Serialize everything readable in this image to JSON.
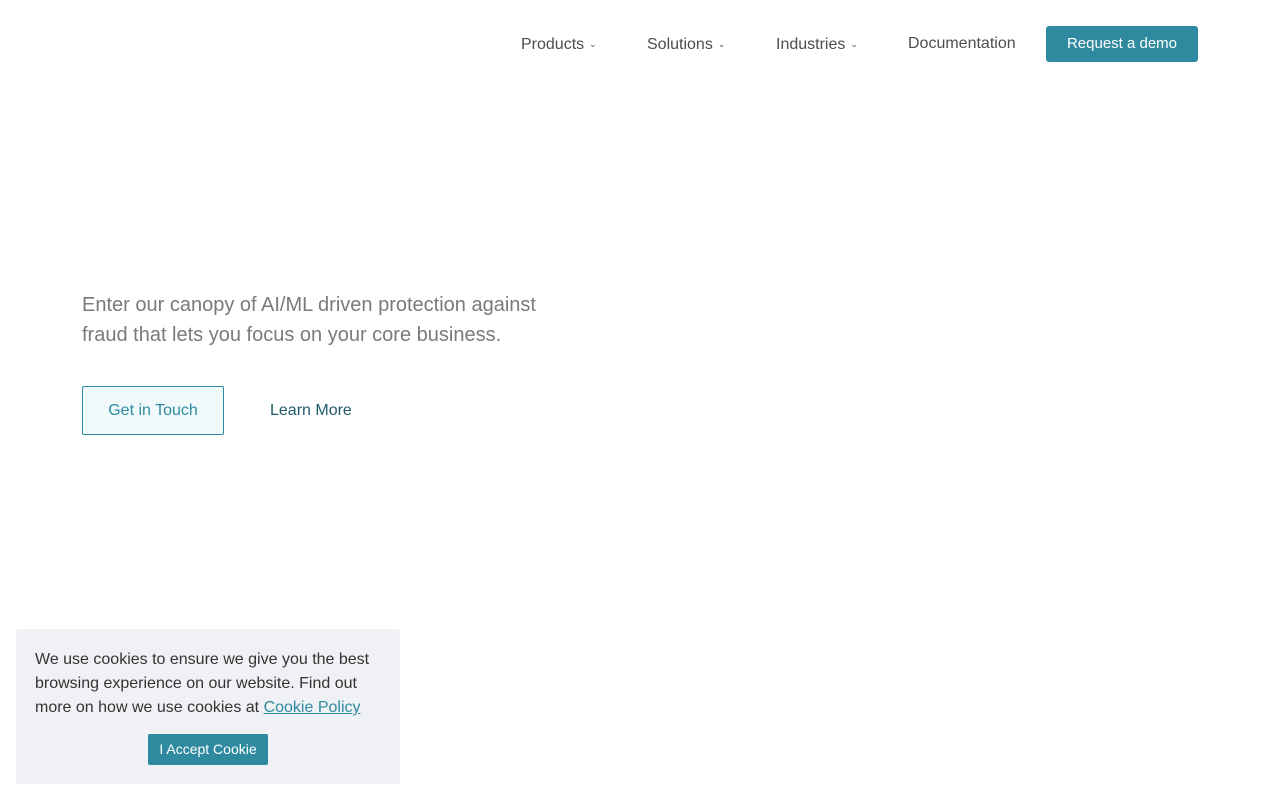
{
  "nav": {
    "items": [
      {
        "label": "Products",
        "has_dropdown": true
      },
      {
        "label": "Solutions",
        "has_dropdown": true
      },
      {
        "label": "Industries",
        "has_dropdown": true
      },
      {
        "label": "Documentation",
        "has_dropdown": false
      }
    ],
    "cta_label": "Request a demo",
    "chevron_glyph": "⌄"
  },
  "hero": {
    "tagline": "Enter our canopy of AI/ML driven protection against fraud that lets you focus on your core business.",
    "primary_button": "Get in Touch",
    "secondary_button": "Learn More"
  },
  "cookie_banner": {
    "message": "We use cookies to ensure we give you the best browsing experience on our website. Find out more on how we use cookies at ",
    "link_label": "Cookie Policy",
    "accept_label": "I Accept Cookie"
  },
  "colors": {
    "accent": "#2f8aa0",
    "nav_text": "#4d4d4d",
    "hero_text": "#7a7a7a",
    "cookie_bg": "#eff1f4"
  }
}
